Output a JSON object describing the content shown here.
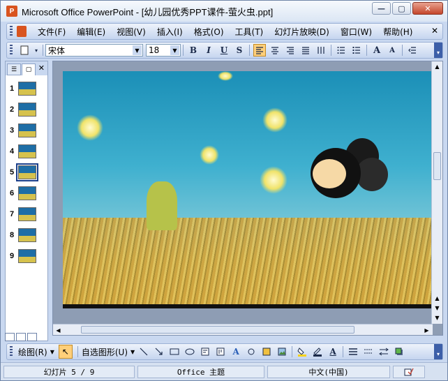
{
  "window": {
    "title": "Microsoft Office PowerPoint - [幼儿园优秀PPT课件-萤火虫.ppt]",
    "app_icon_letter": "P",
    "controls": {
      "minimize": "—",
      "maximize": "▢",
      "close": "✕"
    }
  },
  "menubar": {
    "items": [
      "文件(F)",
      "编辑(E)",
      "视图(V)",
      "插入(I)",
      "格式(O)",
      "工具(T)",
      "幻灯片放映(D)",
      "窗口(W)",
      "帮助(H)"
    ],
    "close_symbol": "✕"
  },
  "format_toolbar": {
    "font_name": "宋体",
    "font_size": "18",
    "bold": "B",
    "italic": "I",
    "underline": "U",
    "shadow": "S",
    "grow_font": "A",
    "shrink_font": "A"
  },
  "slides_panel": {
    "thumbnails": [
      "1",
      "2",
      "3",
      "4",
      "5",
      "6",
      "7",
      "8",
      "9"
    ],
    "selected": "5"
  },
  "draw_toolbar": {
    "draw_label": "绘图(R)",
    "autoshapes_label": "自选图形(U)"
  },
  "statusbar": {
    "slide_info": "幻灯片 5 / 9",
    "theme": "Office 主题",
    "language": "中文(中国)"
  },
  "colors": {
    "accent": "#3d5fa8",
    "toolbar": "#c5d5ef",
    "active_button": "#ffcf7a"
  }
}
